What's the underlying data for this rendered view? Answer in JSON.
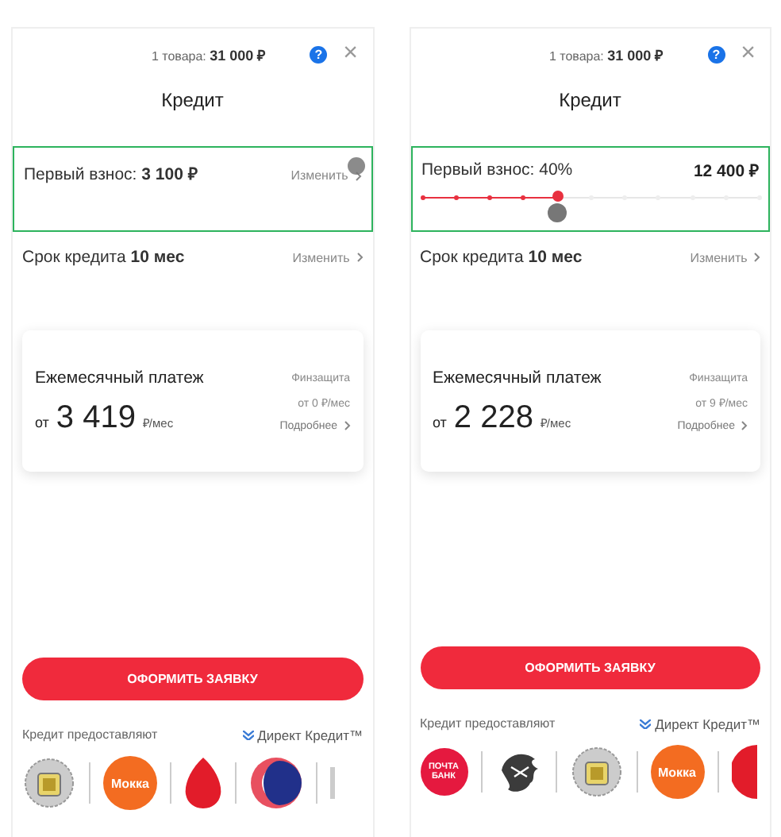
{
  "screens": [
    {
      "cart": {
        "label": "1 товара:",
        "total": "31 000 ₽"
      },
      "help": "?",
      "close": "×",
      "title": "Кредит",
      "down_payment": {
        "kind": "collapsed",
        "highlighted": true,
        "label": "Первый взнос:",
        "value": "3 100 ₽",
        "action": "Изменить",
        "touch": true
      },
      "term": {
        "label": "Срок кредита",
        "value": "10 мес",
        "action": "Изменить"
      },
      "payment": {
        "title": "Ежемесячный платеж",
        "prefix": "от",
        "amount": "3 419",
        "unit": "₽/мес",
        "insurance": "Финзащита",
        "insurance_price": "от 0 ₽/мес",
        "more": "Подробнее"
      },
      "submit": "ОФОРМИТЬ ЗАЯВКУ",
      "providers_label": "Кредит предоставляют",
      "partner": "Директ Кредит™",
      "banks": [
        {
          "kind": "crest"
        },
        {
          "kind": "mokka",
          "text": "Мокка"
        },
        {
          "kind": "egg"
        },
        {
          "kind": "ring"
        },
        {
          "kind": "edge"
        }
      ]
    },
    {
      "cart": {
        "label": "1 товара:",
        "total": "31 000 ₽"
      },
      "help": "?",
      "close": "×",
      "title": "Кредит",
      "down_payment": {
        "kind": "slider",
        "highlighted": true,
        "label": "Первый взнос: 40%",
        "value": "12 400 ₽",
        "level": 0.4,
        "touch": true
      },
      "term": {
        "label": "Срок кредита",
        "value": "10 мес",
        "action": "Изменить"
      },
      "payment": {
        "title": "Ежемесячный платеж",
        "prefix": "от",
        "amount": "2 228",
        "unit": "₽/мес",
        "insurance": "Финзащита",
        "insurance_price": "от 9 ₽/мес",
        "more": "Подробнее"
      },
      "submit": "ОФОРМИТЬ ЗАЯВКУ",
      "providers_label": "Кредит предоставляют",
      "partner": "Директ Кредит™",
      "banks": [
        {
          "kind": "pochta",
          "text": "ПОЧТА БАНК"
        },
        {
          "kind": "beast"
        },
        {
          "kind": "crest"
        },
        {
          "kind": "mokka",
          "text": "Мокка"
        },
        {
          "kind": "redcircle"
        }
      ]
    }
  ]
}
